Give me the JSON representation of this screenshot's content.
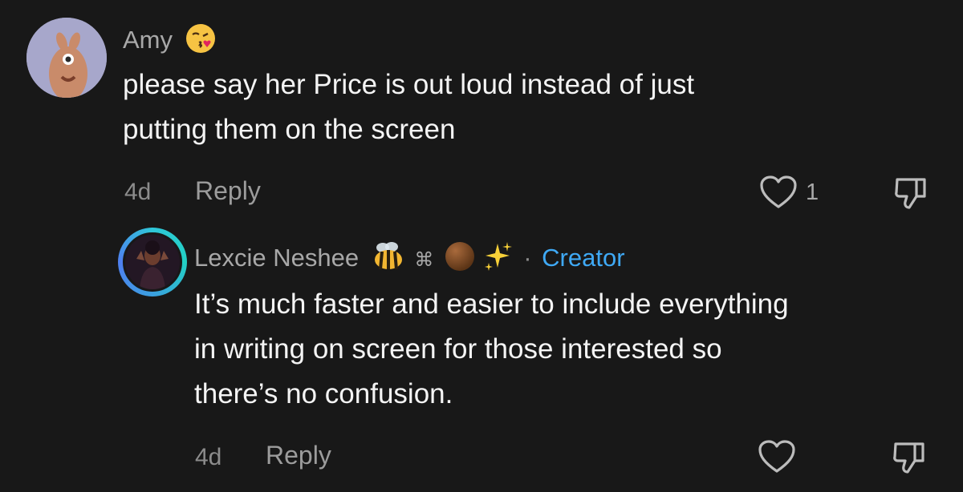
{
  "comments": [
    {
      "username": "Amy",
      "text": "please say her Price is out loud instead of just\nputting them on the screen",
      "time": "4d",
      "reply_label": "Reply",
      "like_count": "1"
    },
    {
      "username": "Lexcie Neshee",
      "name_symbol": "⌘",
      "separator": "·",
      "badge": "Creator",
      "text": "It’s much faster and easier to include everything\nin writing on screen for those interested so\nthere’s no confusion.",
      "time": "4d",
      "reply_label": "Reply"
    }
  ],
  "colors": {
    "background": "#181818",
    "creator_badge": "#3fa9f5",
    "secondary_text": "#a8a8a8"
  },
  "icons": [
    "heart-outline-icon",
    "thumbs-down-icon",
    "kiss-emoji-icon",
    "bee-emoji-icon",
    "brown-circle-emoji-icon",
    "sparkles-emoji-icon"
  ]
}
